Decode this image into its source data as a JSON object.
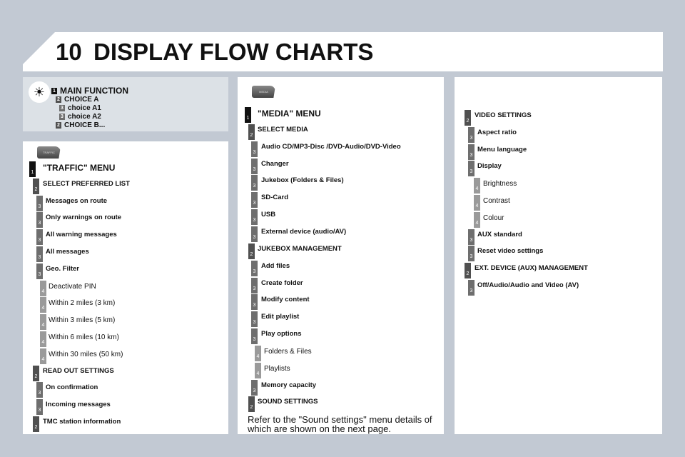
{
  "header": {
    "chapter": "10",
    "title": "DISPLAY FLOW CHARTS"
  },
  "colors": {
    "level1": "#111111",
    "level2": "#505050",
    "level3": "#6e6e6e",
    "level4": "#9a9a9a",
    "background": "#c2c9d3"
  },
  "legend": {
    "icon": "lightbulb-icon",
    "items": [
      {
        "level": 1,
        "label": "MAIN FUNCTION"
      },
      {
        "level": 2,
        "label": "CHOICE A"
      },
      {
        "level": 3,
        "label": "choice A1"
      },
      {
        "level": 3,
        "label": "choice A2"
      },
      {
        "level": 2,
        "label": "CHOICE B..."
      }
    ]
  },
  "traffic": {
    "tab_label": "TRAFFIC",
    "items": [
      {
        "level": 1,
        "label": "\"TRAFFIC\" MENU"
      },
      {
        "level": 2,
        "label": "SELECT PREFERRED LIST"
      },
      {
        "level": 3,
        "label": "Messages on route"
      },
      {
        "level": 3,
        "label": "Only warnings on route"
      },
      {
        "level": 3,
        "label": "All warning messages"
      },
      {
        "level": 3,
        "label": "All messages"
      },
      {
        "level": 3,
        "label": "Geo. Filter"
      },
      {
        "level": 4,
        "label": "Deactivate PIN"
      },
      {
        "level": 4,
        "label": "Within 2 miles (3 km)"
      },
      {
        "level": 4,
        "label": "Within 3 miles (5 km)"
      },
      {
        "level": 4,
        "label": "Within 6 miles (10 km)"
      },
      {
        "level": 4,
        "label": "Within 30 miles (50 km)"
      },
      {
        "level": 2,
        "label": "READ OUT SETTINGS"
      },
      {
        "level": 3,
        "label": "On confirmation"
      },
      {
        "level": 3,
        "label": "Incoming messages"
      },
      {
        "level": 2,
        "label": "TMC station information"
      }
    ]
  },
  "media": {
    "tab_label": "MEDIA",
    "items": [
      {
        "level": 1,
        "label": "\"MEDIA\" MENU"
      },
      {
        "level": 2,
        "label": "SELECT MEDIA"
      },
      {
        "level": 3,
        "label": "Audio CD/MP3-Disc /DVD-Audio/DVD-Video"
      },
      {
        "level": 3,
        "label": "Changer"
      },
      {
        "level": 3,
        "label": "Jukebox (Folders & Files)"
      },
      {
        "level": 3,
        "label": "SD-Card"
      },
      {
        "level": 3,
        "label": "USB"
      },
      {
        "level": 3,
        "label": "External device (audio/AV)"
      },
      {
        "level": 2,
        "label": "JUKEBOX MANAGEMENT"
      },
      {
        "level": 3,
        "label": "Add files"
      },
      {
        "level": 3,
        "label": "Create folder"
      },
      {
        "level": 3,
        "label": "Modify content"
      },
      {
        "level": 3,
        "label": "Edit playlist"
      },
      {
        "level": 3,
        "label": "Play options"
      },
      {
        "level": 4,
        "label": "Folders & Files"
      },
      {
        "level": 4,
        "label": "Playlists"
      },
      {
        "level": 3,
        "label": "Memory capacity"
      },
      {
        "level": 2,
        "label": "SOUND SETTINGS"
      }
    ],
    "note": "Refer to the \"Sound settings\" menu details of which are shown on the next page."
  },
  "video": {
    "items": [
      {
        "level": 2,
        "label": "VIDEO SETTINGS"
      },
      {
        "level": 3,
        "label": "Aspect ratio"
      },
      {
        "level": 3,
        "label": "Menu language"
      },
      {
        "level": 3,
        "label": "Display"
      },
      {
        "level": 4,
        "label": "Brightness"
      },
      {
        "level": 4,
        "label": "Contrast"
      },
      {
        "level": 4,
        "label": "Colour"
      },
      {
        "level": 3,
        "label": "AUX standard"
      },
      {
        "level": 3,
        "label": "Reset video settings"
      },
      {
        "level": 2,
        "label": "EXT. DEVICE (AUX) MANAGEMENT"
      },
      {
        "level": 3,
        "label": "Off/Audio/Audio and Video (AV)"
      }
    ]
  }
}
